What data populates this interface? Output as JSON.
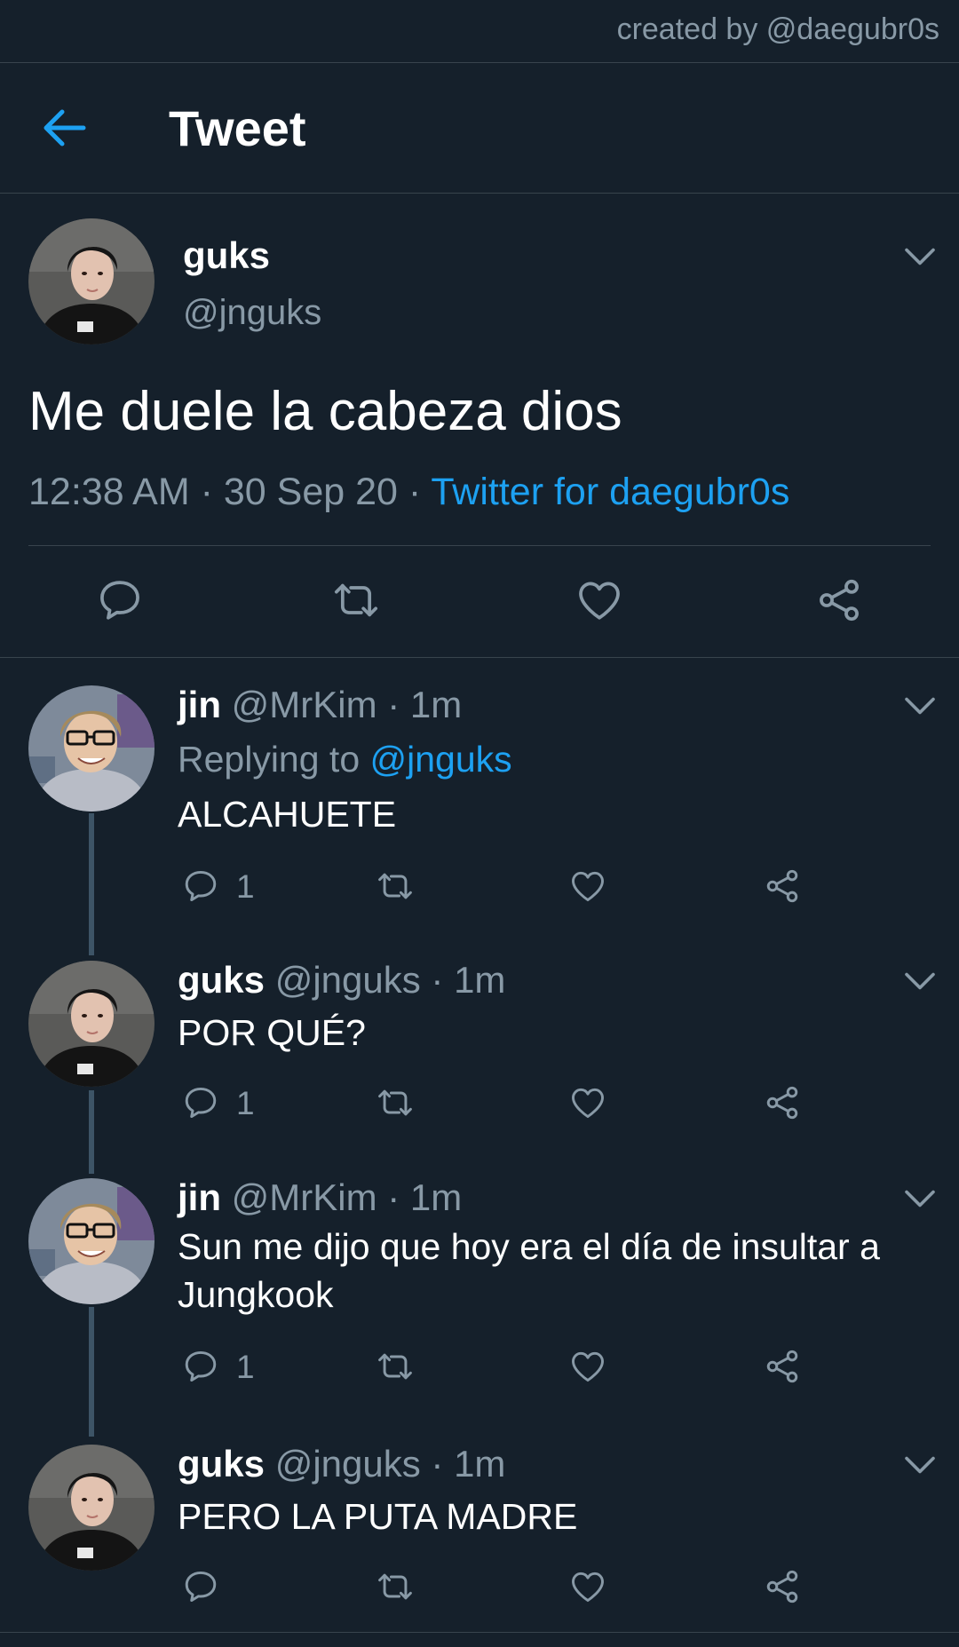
{
  "watermark": "created by @daegubr0s",
  "header": {
    "title": "Tweet",
    "back_icon": "arrow-left-icon"
  },
  "colors": {
    "background": "#15202b",
    "accent": "#1da1f2",
    "secondary_text": "#8899a6",
    "divider": "#38444d"
  },
  "main_tweet": {
    "name": "guks",
    "handle": "@jnguks",
    "text": "Me duele la cabeza dios",
    "time": "12:38 AM · 30 Sep 20 · ",
    "source": "Twitter for daegubr0s"
  },
  "replies": [
    {
      "name": "jin",
      "meta": " @MrKim · 1m",
      "replying_prefix": "Replying to ",
      "replying_handle": "@jnguks",
      "text": "ALCAHUETE",
      "reply_count": "1"
    },
    {
      "name": "guks",
      "meta": " @jnguks · 1m",
      "text": "POR QUÉ?",
      "reply_count": "1"
    },
    {
      "name": "jin",
      "meta": " @MrKim · 1m",
      "text": "Sun me dijo que hoy era el día de insultar a Jungkook",
      "reply_count": "1"
    },
    {
      "name": "guks",
      "meta": " @jnguks · 1m",
      "text": "PERO LA PUTA MADRE",
      "reply_count": ""
    }
  ]
}
